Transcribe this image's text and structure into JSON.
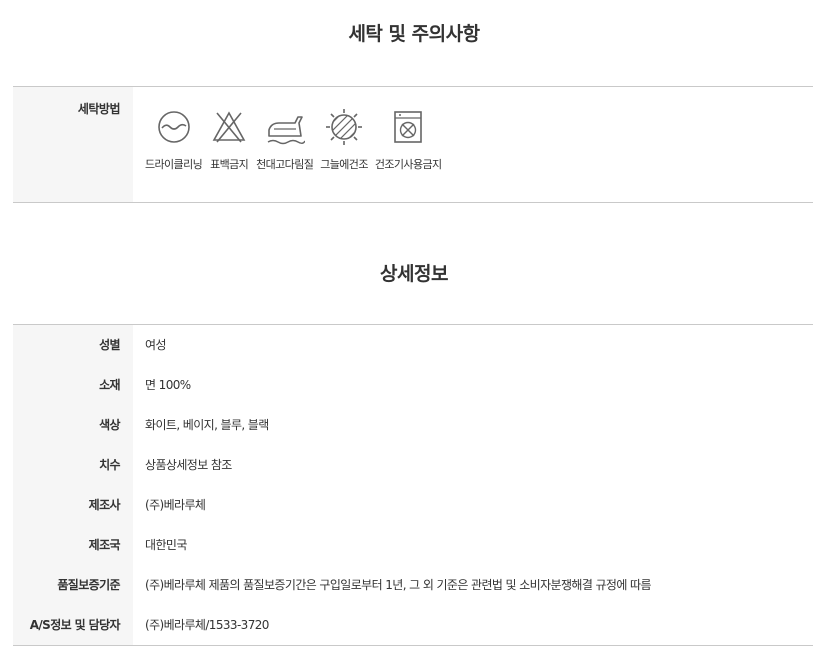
{
  "care": {
    "title": "세탁 및 주의사항",
    "row_label": "세탁방법",
    "items": [
      {
        "label": "드라이클리닝",
        "icon": "dry-clean-icon"
      },
      {
        "label": "표백금지",
        "icon": "no-bleach-icon"
      },
      {
        "label": "천대고다림질",
        "icon": "iron-icon"
      },
      {
        "label": "그늘에건조",
        "icon": "shade-dry-icon"
      },
      {
        "label": "건조기사용금지",
        "icon": "no-tumble-dry-icon"
      }
    ]
  },
  "detail": {
    "title": "상세정보",
    "rows": [
      {
        "label": "성별",
        "value": "여성"
      },
      {
        "label": "소재",
        "value": "면 100%"
      },
      {
        "label": "색상",
        "value": "화이트, 베이지, 블루, 블랙"
      },
      {
        "label": "치수",
        "value": "상품상세정보 참조"
      },
      {
        "label": "제조사",
        "value": "(주)베라루체"
      },
      {
        "label": "제조국",
        "value": "대한민국"
      },
      {
        "label": "품질보증기준",
        "value": "(주)베라루체 제품의 품질보증기간은 구입일로부터 1년, 그 외 기준은 관련법 및 소비자분쟁해결 규정에 따름"
      },
      {
        "label": "A/S정보 및 담당자",
        "value": "(주)베라루체/1533-3720"
      }
    ]
  }
}
